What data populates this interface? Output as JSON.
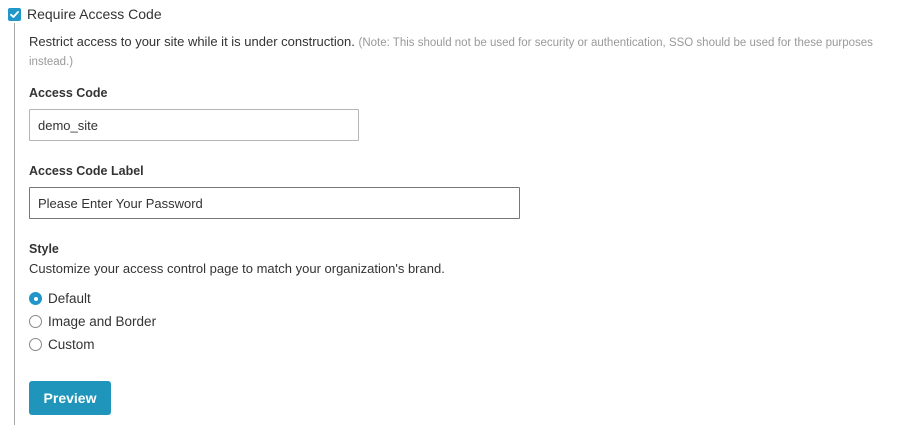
{
  "require_access": {
    "label": "Require Access Code",
    "checked": true
  },
  "description": {
    "main": "Restrict access to your site while it is under construction.",
    "note": "(Note: This should not be used for security or authentication, SSO should be used for these purposes instead.)"
  },
  "access_code": {
    "label": "Access Code",
    "value": "demo_site"
  },
  "access_code_label": {
    "label": "Access Code Label",
    "value": "Please Enter Your Password"
  },
  "style": {
    "label": "Style",
    "description": "Customize your access control page to match your organization's brand.",
    "options": [
      {
        "label": "Default",
        "selected": true
      },
      {
        "label": "Image and Border",
        "selected": false
      },
      {
        "label": "Custom",
        "selected": false
      }
    ]
  },
  "preview_button": {
    "label": "Preview"
  },
  "colors": {
    "accent": "#2196c9",
    "button": "#1f95bb"
  }
}
